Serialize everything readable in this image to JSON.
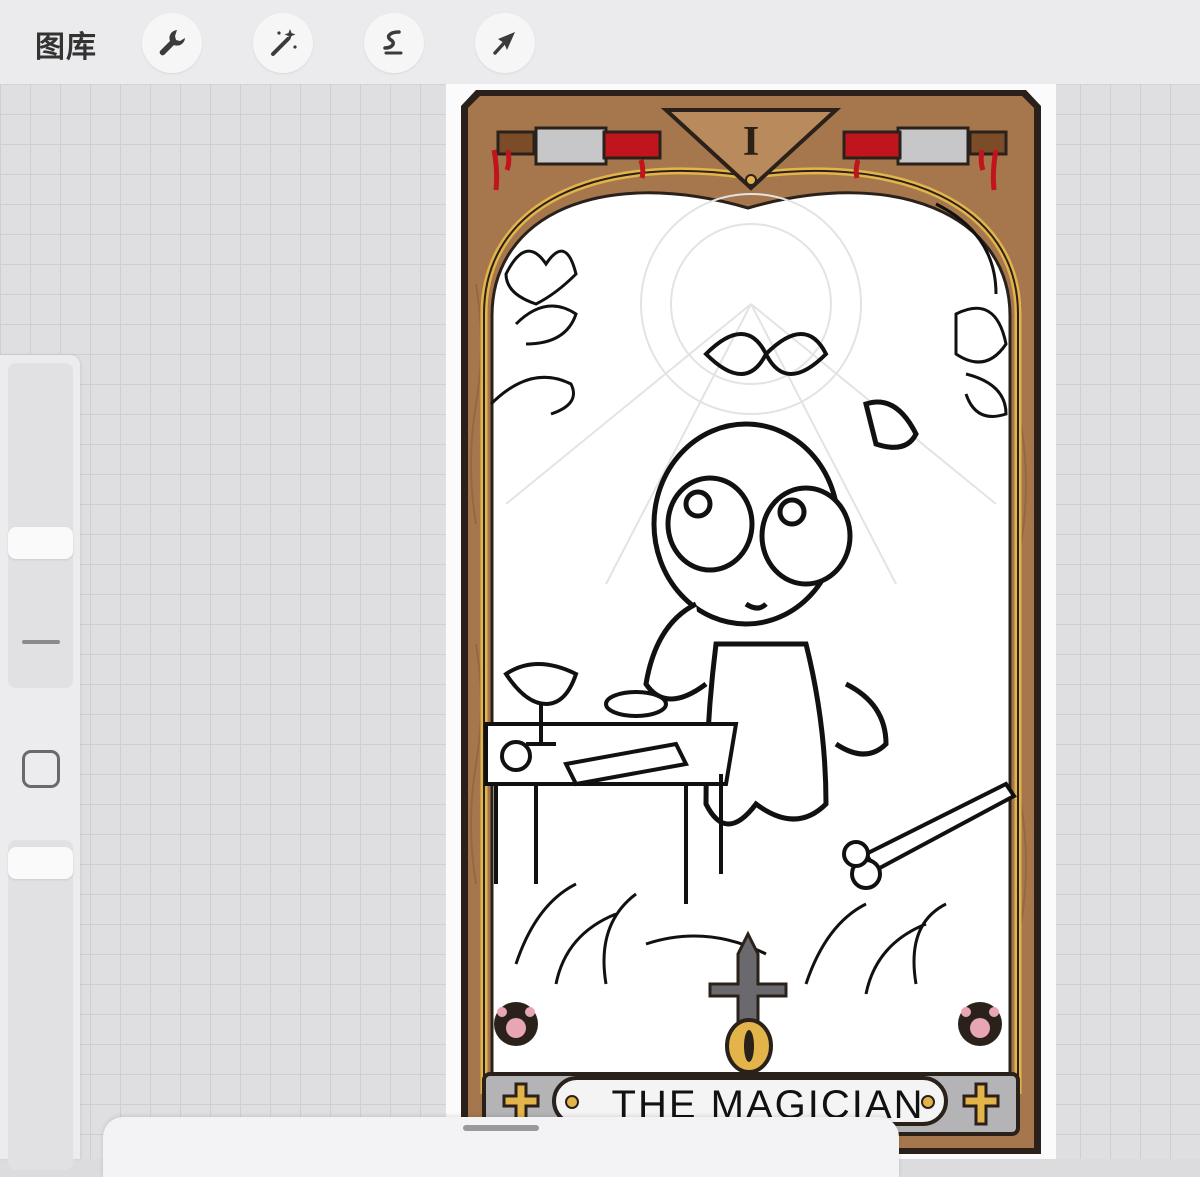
{
  "topbar": {
    "gallery_label": "图库",
    "tools": [
      {
        "name": "wrench-icon",
        "label": "Actions"
      },
      {
        "name": "magic-wand-icon",
        "label": "Adjustments"
      },
      {
        "name": "selection-icon",
        "label": "Selection"
      },
      {
        "name": "arrow-icon",
        "label": "Transform"
      }
    ]
  },
  "card": {
    "numeral": "I",
    "title": "THE MAGICIAN",
    "frame_color": "#a6774d",
    "border_color": "#2a211b",
    "gold_color": "#e2b44a",
    "blood_color": "#c0151c"
  },
  "colors": {
    "workspace_bg": "#dfdfe2",
    "grid_line": "#cfcfd3",
    "toolbar_bg": "#ebebed"
  }
}
